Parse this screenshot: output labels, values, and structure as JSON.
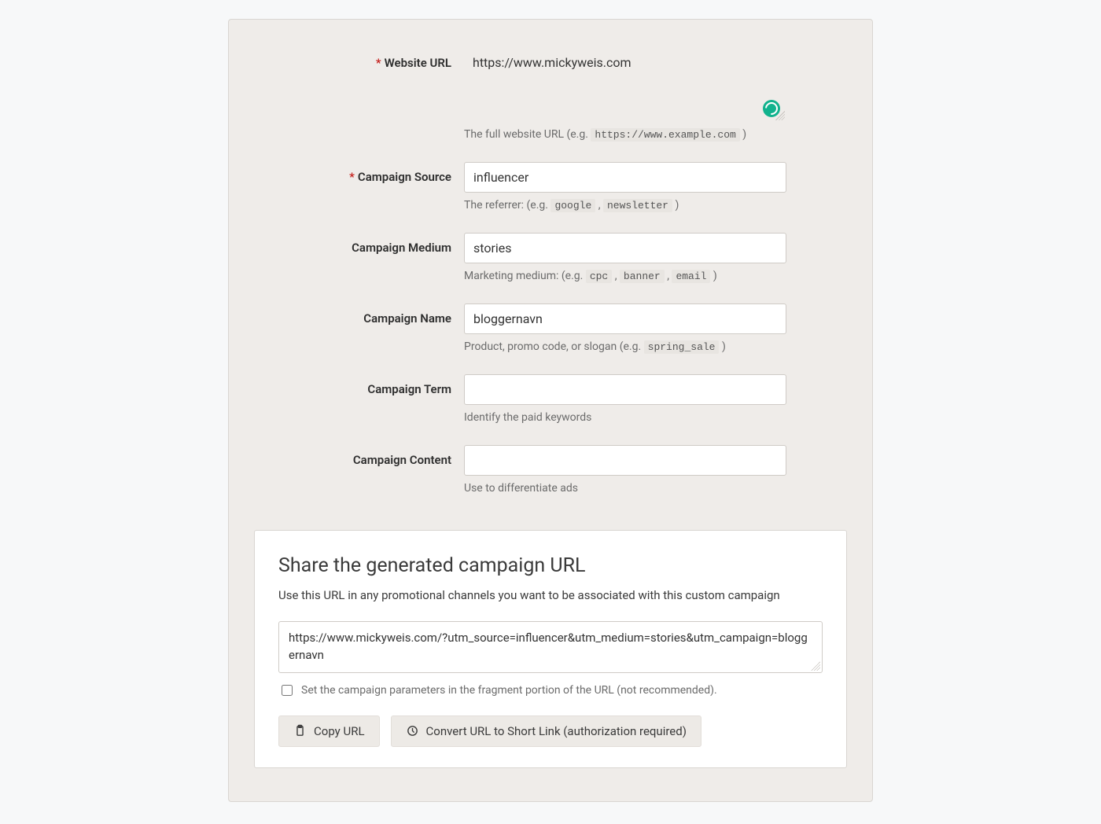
{
  "form": {
    "website_url": {
      "label": "Website URL",
      "required": true,
      "value": "https://www.mickyweis.com",
      "hint_pre": "The full website URL (e.g. ",
      "hint_code": "https://www.example.com",
      "hint_post": " )"
    },
    "campaign_source": {
      "label": "Campaign Source",
      "required": true,
      "value": "influencer",
      "hint_pre": "The referrer: (e.g. ",
      "hint_codes": [
        "google",
        "newsletter"
      ],
      "hint_sep": " , ",
      "hint_post": " )"
    },
    "campaign_medium": {
      "label": "Campaign Medium",
      "required": false,
      "value": "stories",
      "hint_pre": "Marketing medium: (e.g. ",
      "hint_codes": [
        "cpc",
        "banner",
        "email"
      ],
      "hint_sep": " , ",
      "hint_post": " )"
    },
    "campaign_name": {
      "label": "Campaign Name",
      "required": false,
      "value": "bloggernavn",
      "hint_pre": "Product, promo code, or slogan (e.g. ",
      "hint_code": "spring_sale",
      "hint_post": " )"
    },
    "campaign_term": {
      "label": "Campaign Term",
      "required": false,
      "value": "",
      "hint_text": "Identify the paid keywords"
    },
    "campaign_content": {
      "label": "Campaign Content",
      "required": false,
      "value": "",
      "hint_text": "Use to differentiate ads"
    }
  },
  "share": {
    "heading": "Share the generated campaign URL",
    "subtext": "Use this URL in any promotional channels you want to be associated with this custom campaign",
    "generated_url": "https://www.mickyweis.com/?utm_source=influencer&utm_medium=stories&utm_campaign=bloggernavn",
    "fragment_option": "Set the campaign parameters in the fragment portion of the URL (not recommended).",
    "fragment_checked": false,
    "copy_button": "Copy URL",
    "shortlink_button": "Convert URL to Short Link (authorization required)"
  },
  "icons": {
    "grammarly": "grammarly-icon",
    "clipboard": "clipboard-icon",
    "link": "shortlink-icon"
  }
}
